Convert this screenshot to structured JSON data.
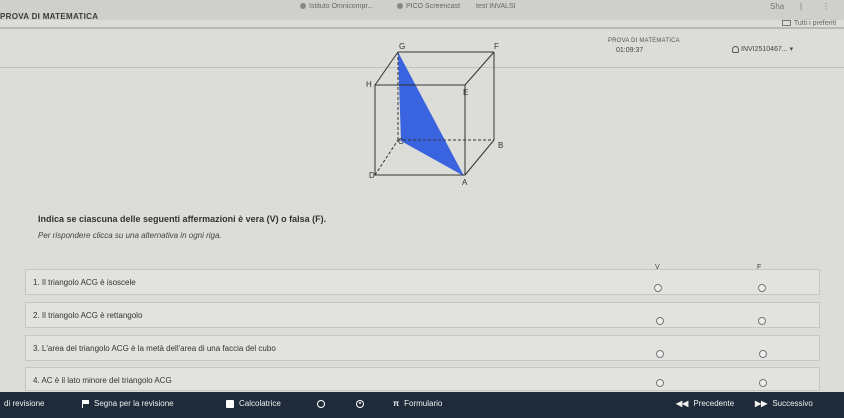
{
  "browser": {
    "tabs": [
      "Istituto Omnicompr...",
      "PICO Screencast",
      "test INVALSI"
    ],
    "bookmarks_label": "Tutti i preferiti",
    "win_label": "Sha"
  },
  "header": {
    "app_title": "PROVA DI MATEMATICA",
    "test_label": "PROVA DI MATEMATICA",
    "timer": "01:09:37",
    "user_id": "INVI2510467..."
  },
  "figure": {
    "vertices": [
      "G",
      "F",
      "H",
      "E",
      "C",
      "B",
      "D",
      "A"
    ],
    "fill_color": "#3a63e0"
  },
  "question": {
    "instruction": "Indica se ciascuna delle seguenti affermazioni è vera (V) o falsa (F).",
    "hint": "Per rispondere clicca su una alternativa in ogni riga.",
    "col_true": "V",
    "col_false": "F",
    "rows": [
      "1. Il triangolo ACG è isoscele",
      "2. Il triangolo ACG è rettangolo",
      "3. L'area del triangolo ACG è la metà dell'area di una faccia del cubo",
      "4. AC è il lato minore del triangolo ACG"
    ]
  },
  "toolbar": {
    "review": "di revisione",
    "mark_review": "Segna per la revisione",
    "calculator": "Calcolatrice",
    "formulas": "Formulario",
    "pi_glyph": "π",
    "prev": "Precedente",
    "next": "Successivo",
    "prev_glyph": "◀◀",
    "next_glyph": "▶▶"
  },
  "colors": {
    "toolbar_bg": "#1f2b3a",
    "accent": "#3a63e0"
  }
}
